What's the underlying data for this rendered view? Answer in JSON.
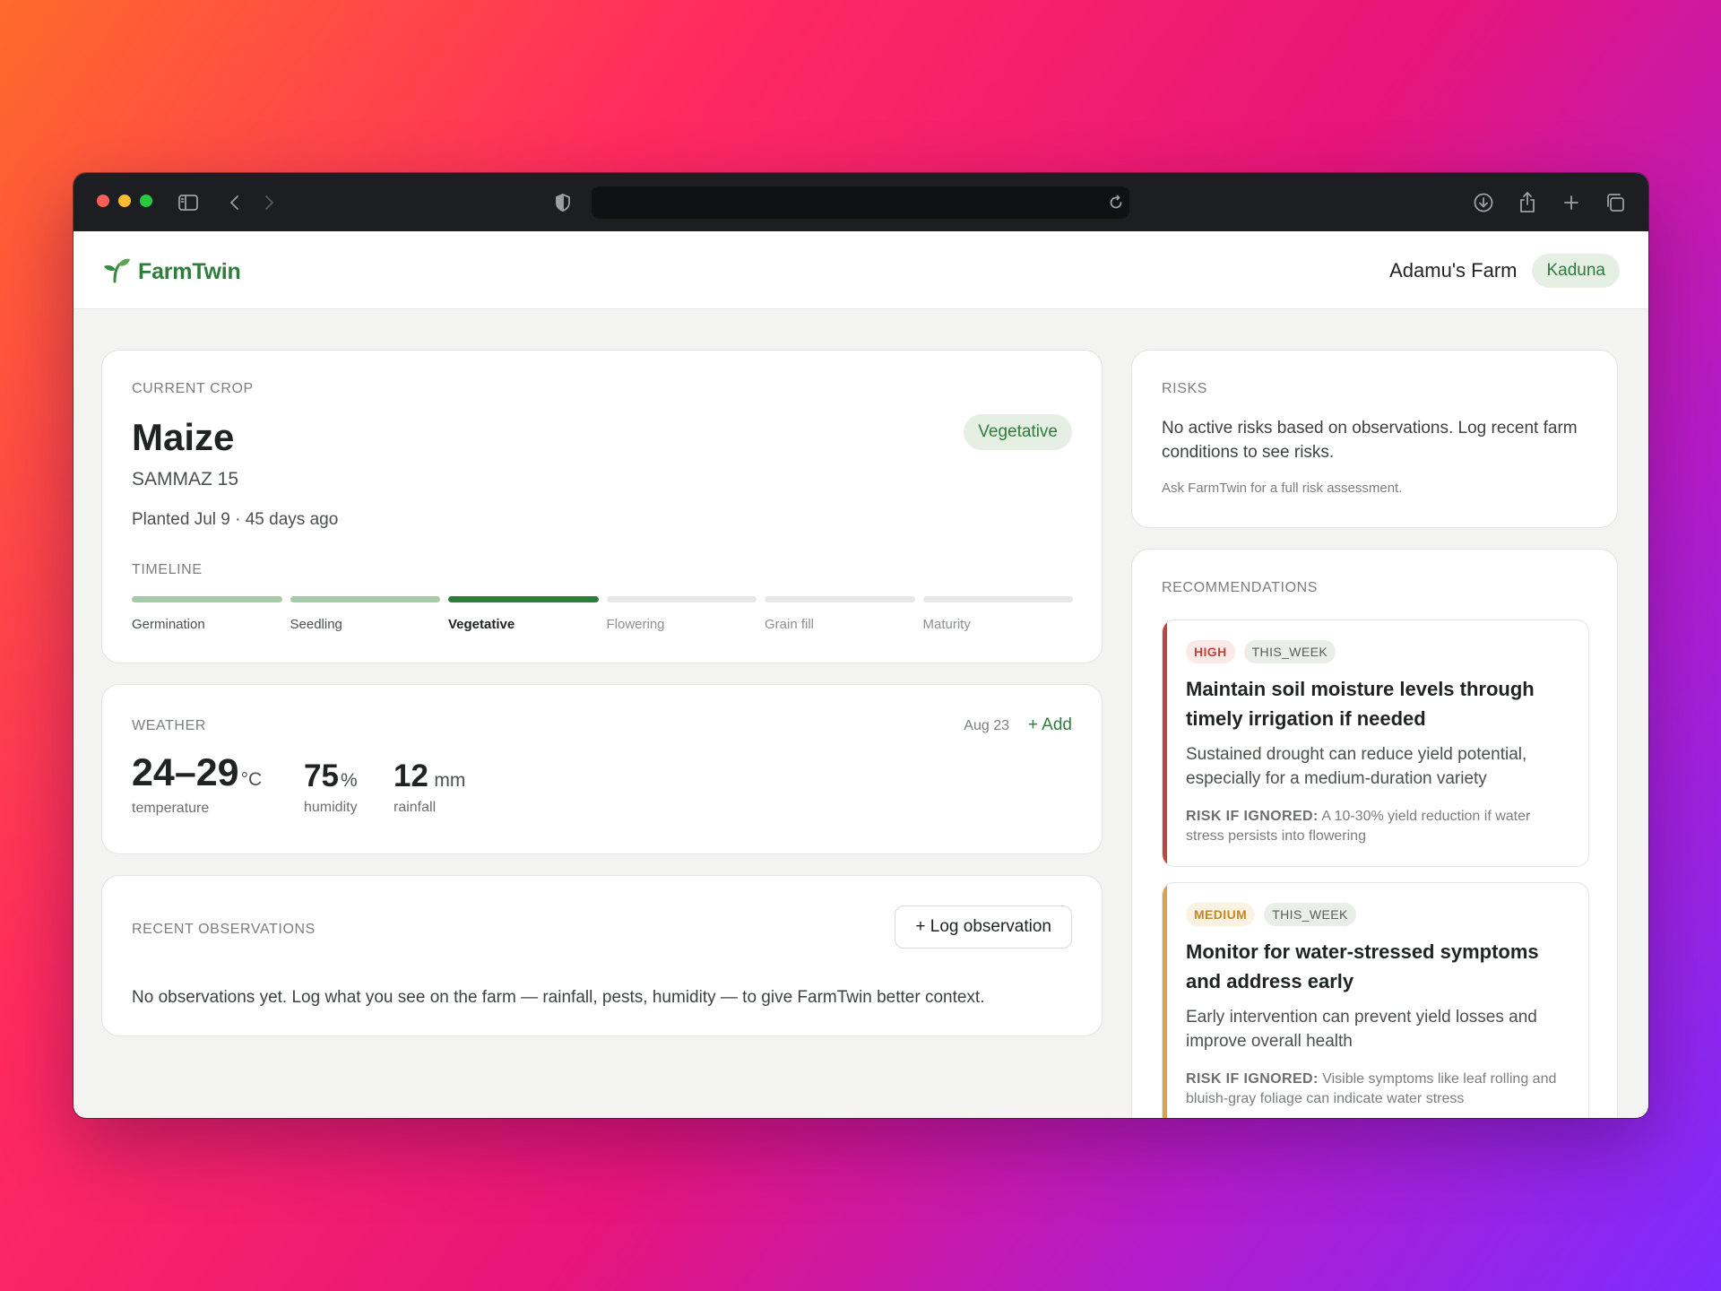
{
  "app": {
    "name": "FarmTwin"
  },
  "header": {
    "farm_name": "Adamu's Farm",
    "location": "Kaduna"
  },
  "crop": {
    "section_label": "CURRENT CROP",
    "name": "Maize",
    "variety": "SAMMAZ 15",
    "planted": "Planted Jul 9 · 45 days ago",
    "stage_badge": "Vegetative",
    "timeline_label": "TIMELINE",
    "timeline": [
      {
        "label": "Germination",
        "state": "done"
      },
      {
        "label": "Seedling",
        "state": "done"
      },
      {
        "label": "Vegetative",
        "state": "current"
      },
      {
        "label": "Flowering",
        "state": "upcoming"
      },
      {
        "label": "Grain fill",
        "state": "upcoming"
      },
      {
        "label": "Maturity",
        "state": "upcoming"
      }
    ]
  },
  "weather": {
    "section_label": "WEATHER",
    "date": "Aug 23",
    "add_label": "+ Add",
    "temperature": {
      "value": "24–29",
      "unit": "°C",
      "caption": "temperature"
    },
    "humidity": {
      "value": "75",
      "unit": "%",
      "caption": "humidity"
    },
    "rainfall": {
      "value": "12",
      "unit": "mm",
      "caption": "rainfall"
    }
  },
  "observations": {
    "section_label": "RECENT OBSERVATIONS",
    "button_label": "+ Log observation",
    "empty_text": "No observations yet. Log what you see on the farm — rainfall, pests, humidity — to give FarmTwin better context."
  },
  "risks": {
    "section_label": "RISKS",
    "text": "No active risks based on observations. Log recent farm conditions to see risks.",
    "note": "Ask FarmTwin for a full risk assessment."
  },
  "recommendations": {
    "section_label": "RECOMMENDATIONS",
    "items": [
      {
        "priority": "HIGH",
        "timing": "THIS_WEEK",
        "title": "Maintain soil moisture levels through timely irrigation if needed",
        "body": "Sustained drought can reduce yield potential, especially for a medium-duration variety",
        "risk_label": "RISK IF IGNORED:",
        "risk_text": "A 10-30% yield reduction if water stress persists into flowering"
      },
      {
        "priority": "MEDIUM",
        "timing": "THIS_WEEK",
        "title": "Monitor for water-stressed symptoms and address early",
        "body": "Early intervention can prevent yield losses and improve overall health",
        "risk_label": "RISK IF IGNORED:",
        "risk_text": "Visible symptoms like leaf rolling and bluish-gray foliage can indicate water stress"
      }
    ]
  },
  "colors": {
    "brand": "#2e7d3a",
    "high": "#c0453f",
    "medium": "#d9a347"
  }
}
